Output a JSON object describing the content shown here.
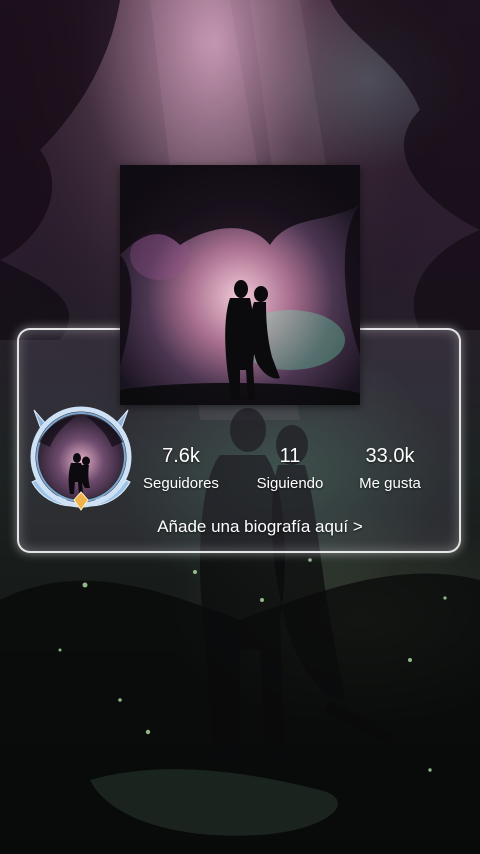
{
  "profile": {
    "stats": [
      {
        "value": "7.6k",
        "label": "Seguidores"
      },
      {
        "value": "11",
        "label": "Siguiendo"
      },
      {
        "value": "33.0k",
        "label": "Me gusta"
      }
    ],
    "bio_prompt": "Añade una biografía aquí >"
  },
  "icons": {
    "avatar": "avatar-badge-icon",
    "chevron": "chevron-right-icon"
  },
  "colors": {
    "text": "#ffffff",
    "card_border": "#ffffff",
    "badge_blue": "#9cc4e8",
    "badge_gold": "#f0b24a"
  }
}
